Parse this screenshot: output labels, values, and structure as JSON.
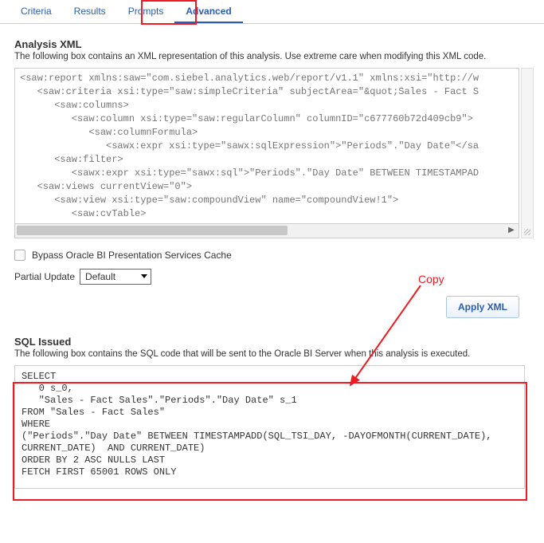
{
  "tabs": {
    "criteria": "Criteria",
    "results": "Results",
    "prompts": "Prompts",
    "advanced": "Advanced"
  },
  "analysis": {
    "title": "Analysis XML",
    "desc": "The following box contains an XML representation of this analysis. Use extreme care when modifying this XML code.",
    "xml": "<saw:report xmlns:saw=\"com.siebel.analytics.web/report/v1.1\" xmlns:xsi=\"http://w\n   <saw:criteria xsi:type=\"saw:simpleCriteria\" subjectArea=\"&quot;Sales - Fact S\n      <saw:columns>\n         <saw:column xsi:type=\"saw:regularColumn\" columnID=\"c677760b72d409cb9\">\n            <saw:columnFormula>\n               <sawx:expr xsi:type=\"sawx:sqlExpression\">\"Periods\".\"Day Date\"</sa\n      <saw:filter>\n         <sawx:expr xsi:type=\"sawx:sql\">\"Periods\".\"Day Date\" BETWEEN TIMESTAMPAD\n   <saw:views currentView=\"0\">\n      <saw:view xsi:type=\"saw:compoundView\" name=\"compoundView!1\">\n         <saw:cvTable>\n            <saw:cvRow>"
  },
  "bypass_label": "Bypass Oracle BI Presentation Services Cache",
  "partial_update": {
    "label": "Partial Update",
    "value": "Default"
  },
  "apply_button": "Apply XML",
  "sql": {
    "title": "SQL Issued",
    "desc": "The following box contains the SQL code that will be sent to the Oracle BI Server when this analysis is executed.",
    "code": "SELECT\n   0 s_0,\n   \"Sales - Fact Sales\".\"Periods\".\"Day Date\" s_1\nFROM \"Sales - Fact Sales\"\nWHERE\n(\"Periods\".\"Day Date\" BETWEEN TIMESTAMPADD(SQL_TSI_DAY, -DAYOFMONTH(CURRENT_DATE),\nCURRENT_DATE)  AND CURRENT_DATE)\nORDER BY 2 ASC NULLS LAST\nFETCH FIRST 65001 ROWS ONLY"
  },
  "annotation": {
    "copy": "Copy"
  }
}
